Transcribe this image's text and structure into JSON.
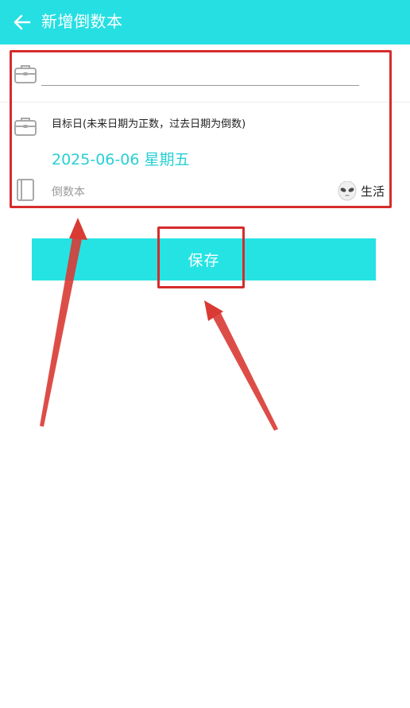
{
  "appbar": {
    "title": "新增倒数本",
    "back_icon": "arrow-left-icon",
    "background_color": "#26dfe3"
  },
  "form": {
    "name_field": {
      "value": "",
      "placeholder": "",
      "icon": "briefcase-icon"
    },
    "target_date": {
      "label": "目标日(未来日期为正数，过去日期为倒数)",
      "value": "2025-06-06 星期五",
      "icon": "briefcase-icon",
      "accent_color": "#26d0d5"
    },
    "book": {
      "label": "倒数本",
      "icon": "book-icon"
    },
    "category": {
      "label": "生活",
      "icon": "alien-face-icon"
    }
  },
  "actions": {
    "save_label": "保存",
    "save_color": "#26e3e3"
  },
  "annotations": {
    "highlight_color": "#d72b2b"
  }
}
